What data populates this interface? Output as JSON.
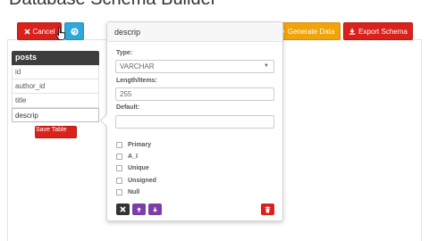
{
  "page": {
    "title": "Database Schema Builder"
  },
  "toolbar": {
    "cancel_label": "Cancel",
    "generate_label": "Generate Data",
    "export_label": "Export Schema"
  },
  "table": {
    "name": "posts",
    "fields": [
      "id",
      "author_id",
      "title",
      "descrip"
    ],
    "save_label": "Save Table"
  },
  "popover": {
    "title": "descrip",
    "type_label": "Type:",
    "type_value": "VARCHAR",
    "length_label": "Length/Items:",
    "length_value": "255",
    "default_label": "Default:",
    "default_value": "",
    "options": [
      "Primary",
      "A_I",
      "Unique",
      "Unsigned",
      "Null"
    ]
  },
  "colors": {
    "danger": "#d9221c",
    "info": "#2ea8d8",
    "warning": "#f0a30a",
    "purple": "#7c3fa8",
    "dark": "#333333"
  }
}
